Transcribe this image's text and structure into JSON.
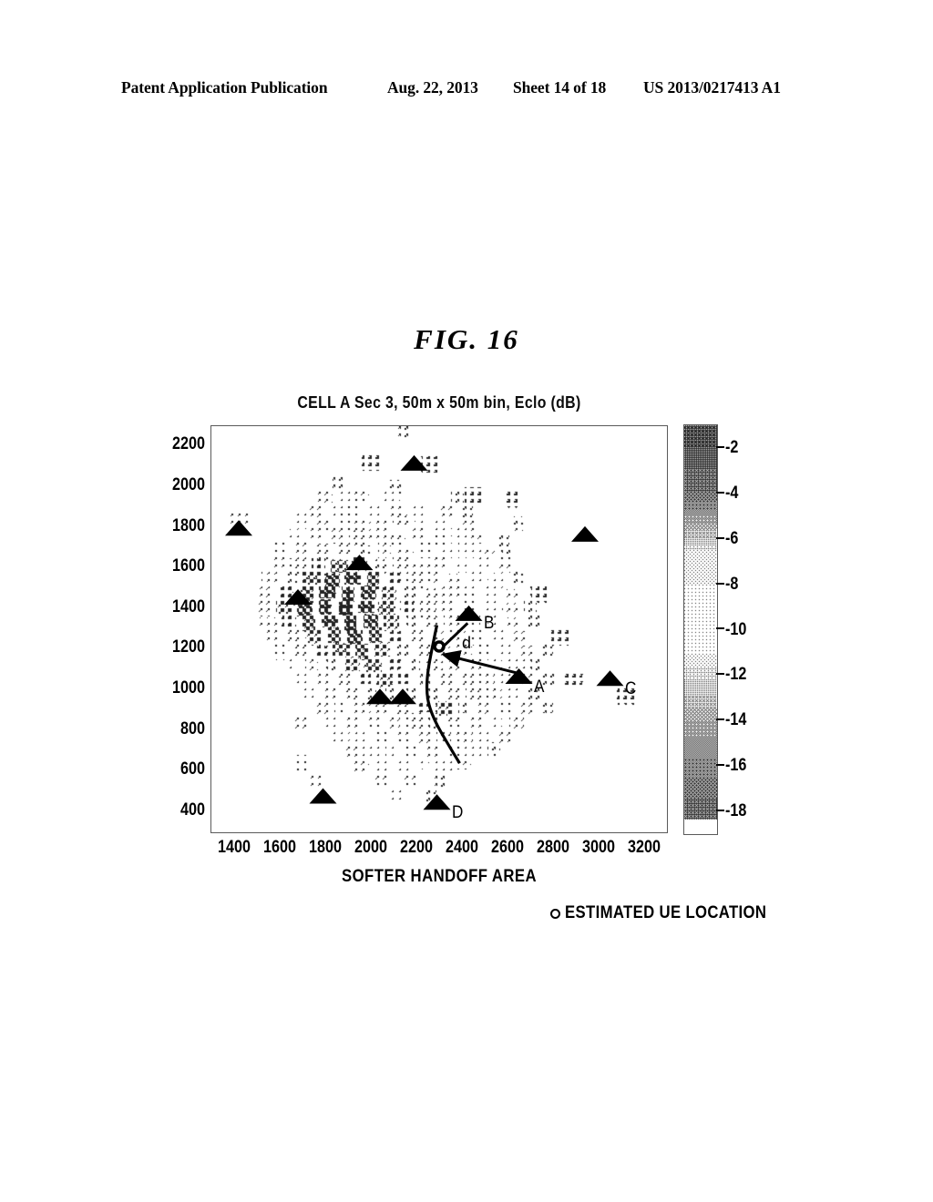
{
  "header": {
    "publication": "Patent Application Publication",
    "date": "Aug. 22, 2013",
    "sheet": "Sheet 14 of 18",
    "number": "US 2013/0217413 A1"
  },
  "figure": {
    "caption": "FIG.  16"
  },
  "legend": {
    "marker_icon": "circle-outline-icon",
    "label": "ESTIMATED UE LOCATION"
  },
  "chart_data": {
    "type": "heatmap",
    "title": "CELL A Sec 3, 50m x 50m bin, Eclo (dB)",
    "xlabel": "SOFTER HANDOFF AREA",
    "ylabel": "",
    "xlim": [
      1300,
      3300
    ],
    "ylim": [
      300,
      2300
    ],
    "xticks": [
      1400,
      1600,
      1800,
      2000,
      2200,
      2400,
      2600,
      2800,
      3000,
      3200
    ],
    "yticks": [
      2200,
      2000,
      1800,
      1600,
      1400,
      1200,
      1000,
      800,
      600,
      400
    ],
    "grid": false,
    "bin_size_m": 50,
    "colorbar": {
      "label": "Eclo (dB)",
      "ticks": [
        -2,
        -4,
        -6,
        -8,
        -10,
        -12,
        -14,
        -16,
        -18
      ],
      "range": [
        -1,
        -19
      ],
      "colormap": "gray-inverted-bow",
      "dark_low": "#2b2b2b",
      "light_mid": "#f2f2f2",
      "dark_high": "#4a4a4a"
    },
    "sites": [
      {
        "label": "",
        "x": 1420,
        "y": 1790
      },
      {
        "label": "",
        "x": 2190,
        "y": 2110
      },
      {
        "label": "",
        "x": 1950,
        "y": 1620
      },
      {
        "label": "",
        "x": 1680,
        "y": 1450
      },
      {
        "label": "",
        "x": 2940,
        "y": 1760
      },
      {
        "label": "B",
        "x": 2430,
        "y": 1370
      },
      {
        "label": "A",
        "x": 2650,
        "y": 1060
      },
      {
        "label": "C",
        "x": 3050,
        "y": 1050
      },
      {
        "label": "",
        "x": 2040,
        "y": 960
      },
      {
        "label": "",
        "x": 2140,
        "y": 960
      },
      {
        "label": "",
        "x": 1790,
        "y": 470
      },
      {
        "label": "D",
        "x": 2290,
        "y": 440
      }
    ],
    "annotations": [
      {
        "name": "estimated-ue-location",
        "type": "circle",
        "x": 2300,
        "y": 1200
      },
      {
        "name": "distance-label",
        "type": "text",
        "text": "d",
        "x": 2420,
        "y": 1180
      },
      {
        "name": "distance-arrow",
        "type": "arrow",
        "from": [
          2650,
          1090
        ],
        "to": [
          2305,
          1190
        ]
      },
      {
        "name": "site-b-pointer",
        "type": "arrow",
        "from": [
          2430,
          1330
        ],
        "to": [
          2305,
          1215
        ]
      },
      {
        "name": "softer-handoff-boundary",
        "type": "curve"
      }
    ],
    "bins": [
      [
        2150,
        2280,
        4
      ],
      [
        2000,
        2120,
        3
      ],
      [
        2260,
        2110,
        3
      ],
      [
        1860,
        2020,
        4
      ],
      [
        2110,
        2000,
        4
      ],
      [
        1800,
        1950,
        5
      ],
      [
        1900,
        1950,
        6
      ],
      [
        1960,
        1960,
        5
      ],
      [
        2090,
        1960,
        6
      ],
      [
        2380,
        1950,
        4
      ],
      [
        2450,
        1960,
        3
      ],
      [
        2620,
        1940,
        3
      ],
      [
        1760,
        1880,
        5
      ],
      [
        1860,
        1890,
        7
      ],
      [
        1930,
        1880,
        8
      ],
      [
        2010,
        1870,
        7
      ],
      [
        2120,
        1890,
        9
      ],
      [
        2210,
        1870,
        6
      ],
      [
        2330,
        1880,
        5
      ],
      [
        2420,
        1880,
        4
      ],
      [
        1420,
        1840,
        10
      ],
      [
        1700,
        1830,
        6
      ],
      [
        1790,
        1820,
        5
      ],
      [
        1880,
        1830,
        8
      ],
      [
        1960,
        1820,
        10
      ],
      [
        2050,
        1810,
        9
      ],
      [
        2130,
        1830,
        12
      ],
      [
        2220,
        1820,
        7
      ],
      [
        2310,
        1820,
        6
      ],
      [
        2430,
        1810,
        5
      ],
      [
        2640,
        1820,
        4
      ],
      [
        1670,
        1760,
        7
      ],
      [
        1760,
        1770,
        9
      ],
      [
        1850,
        1760,
        11
      ],
      [
        1940,
        1750,
        13
      ],
      [
        2030,
        1760,
        10
      ],
      [
        2120,
        1750,
        12
      ],
      [
        2210,
        1760,
        9
      ],
      [
        2300,
        1750,
        8
      ],
      [
        2390,
        1760,
        6
      ],
      [
        2470,
        1750,
        5
      ],
      [
        2580,
        1740,
        4
      ],
      [
        1610,
        1690,
        8
      ],
      [
        1700,
        1690,
        11
      ],
      [
        1790,
        1680,
        13
      ],
      [
        1880,
        1690,
        12
      ],
      [
        1970,
        1680,
        14
      ],
      [
        2060,
        1690,
        11
      ],
      [
        2150,
        1680,
        10
      ],
      [
        2240,
        1690,
        8
      ],
      [
        2330,
        1680,
        7
      ],
      [
        2420,
        1690,
        6
      ],
      [
        2510,
        1680,
        5
      ],
      [
        2600,
        1680,
        4
      ],
      [
        1950,
        1620,
        16
      ],
      [
        1590,
        1620,
        9
      ],
      [
        1680,
        1610,
        13
      ],
      [
        1770,
        1620,
        15
      ],
      [
        1860,
        1610,
        17
      ],
      [
        2040,
        1610,
        14
      ],
      [
        2130,
        1620,
        12
      ],
      [
        2220,
        1610,
        10
      ],
      [
        2310,
        1620,
        9
      ],
      [
        2400,
        1610,
        7
      ],
      [
        2490,
        1620,
        6
      ],
      [
        2580,
        1610,
        5
      ],
      [
        1560,
        1550,
        10
      ],
      [
        1650,
        1540,
        14
      ],
      [
        1740,
        1550,
        17
      ],
      [
        1830,
        1540,
        19
      ],
      [
        1920,
        1550,
        20
      ],
      [
        2010,
        1540,
        18
      ],
      [
        2100,
        1550,
        15
      ],
      [
        2190,
        1540,
        13
      ],
      [
        2280,
        1550,
        11
      ],
      [
        2370,
        1540,
        9
      ],
      [
        2460,
        1550,
        7
      ],
      [
        2550,
        1540,
        6
      ],
      [
        2640,
        1550,
        4
      ],
      [
        1540,
        1470,
        11
      ],
      [
        1630,
        1480,
        15
      ],
      [
        1720,
        1470,
        18
      ],
      [
        1810,
        1480,
        20
      ],
      [
        1900,
        1470,
        21
      ],
      [
        1990,
        1480,
        19
      ],
      [
        2080,
        1470,
        16
      ],
      [
        2170,
        1480,
        14
      ],
      [
        2260,
        1470,
        12
      ],
      [
        2350,
        1480,
        10
      ],
      [
        2440,
        1470,
        8
      ],
      [
        2530,
        1480,
        6
      ],
      [
        2620,
        1470,
        5
      ],
      [
        2740,
        1470,
        3
      ],
      [
        1680,
        1450,
        16
      ],
      [
        1530,
        1400,
        11
      ],
      [
        1620,
        1410,
        16
      ],
      [
        1710,
        1400,
        19
      ],
      [
        1800,
        1410,
        21
      ],
      [
        1890,
        1400,
        22
      ],
      [
        1980,
        1410,
        20
      ],
      [
        2070,
        1400,
        17
      ],
      [
        2160,
        1410,
        15
      ],
      [
        2250,
        1400,
        13
      ],
      [
        2340,
        1410,
        10
      ],
      [
        2430,
        1400,
        8
      ],
      [
        2520,
        1410,
        6
      ],
      [
        2610,
        1400,
        5
      ],
      [
        2700,
        1410,
        4
      ],
      [
        1550,
        1330,
        10
      ],
      [
        1640,
        1340,
        15
      ],
      [
        1730,
        1330,
        18
      ],
      [
        1820,
        1340,
        20
      ],
      [
        1910,
        1330,
        21
      ],
      [
        2000,
        1340,
        19
      ],
      [
        2090,
        1330,
        16
      ],
      [
        2180,
        1340,
        14
      ],
      [
        2270,
        1330,
        12
      ],
      [
        2360,
        1340,
        10
      ],
      [
        2450,
        1330,
        8
      ],
      [
        2540,
        1340,
        7
      ],
      [
        2630,
        1330,
        5
      ],
      [
        2720,
        1340,
        4
      ],
      [
        1570,
        1260,
        9
      ],
      [
        1660,
        1270,
        13
      ],
      [
        1750,
        1260,
        16
      ],
      [
        1840,
        1270,
        18
      ],
      [
        1930,
        1260,
        19
      ],
      [
        2020,
        1270,
        18
      ],
      [
        2110,
        1260,
        15
      ],
      [
        2200,
        1270,
        13
      ],
      [
        2290,
        1260,
        11
      ],
      [
        2380,
        1270,
        9
      ],
      [
        2470,
        1260,
        8
      ],
      [
        2560,
        1270,
        6
      ],
      [
        2650,
        1260,
        5
      ],
      [
        2830,
        1260,
        3
      ],
      [
        1600,
        1190,
        8
      ],
      [
        1690,
        1200,
        12
      ],
      [
        1780,
        1190,
        15
      ],
      [
        1870,
        1200,
        17
      ],
      [
        1960,
        1190,
        18
      ],
      [
        2050,
        1200,
        16
      ],
      [
        2140,
        1190,
        14
      ],
      [
        2230,
        1200,
        12
      ],
      [
        2320,
        1190,
        11
      ],
      [
        2410,
        1200,
        9
      ],
      [
        2500,
        1190,
        8
      ],
      [
        2590,
        1200,
        6
      ],
      [
        2680,
        1190,
        5
      ],
      [
        2770,
        1200,
        4
      ],
      [
        1650,
        1120,
        7
      ],
      [
        1740,
        1130,
        11
      ],
      [
        1830,
        1120,
        14
      ],
      [
        1920,
        1130,
        16
      ],
      [
        2010,
        1120,
        17
      ],
      [
        2100,
        1130,
        15
      ],
      [
        2190,
        1120,
        14
      ],
      [
        2280,
        1130,
        13
      ],
      [
        2370,
        1120,
        11
      ],
      [
        2460,
        1130,
        9
      ],
      [
        2550,
        1120,
        7
      ],
      [
        2640,
        1130,
        6
      ],
      [
        2730,
        1120,
        4
      ],
      [
        1700,
        1050,
        7
      ],
      [
        1790,
        1060,
        10
      ],
      [
        1880,
        1050,
        13
      ],
      [
        1970,
        1060,
        15
      ],
      [
        2060,
        1050,
        16
      ],
      [
        2150,
        1060,
        15
      ],
      [
        2240,
        1050,
        14
      ],
      [
        2330,
        1060,
        13
      ],
      [
        2420,
        1050,
        12
      ],
      [
        2510,
        1060,
        9
      ],
      [
        2600,
        1050,
        7
      ],
      [
        2690,
        1060,
        5
      ],
      [
        2780,
        1050,
        4
      ],
      [
        2890,
        1050,
        3
      ],
      [
        1730,
        980,
        6
      ],
      [
        1820,
        990,
        9
      ],
      [
        1910,
        980,
        12
      ],
      [
        2000,
        990,
        14
      ],
      [
        2090,
        980,
        14
      ],
      [
        2180,
        990,
        14
      ],
      [
        2270,
        980,
        14
      ],
      [
        2360,
        990,
        13
      ],
      [
        2450,
        980,
        12
      ],
      [
        2540,
        990,
        9
      ],
      [
        2630,
        980,
        6
      ],
      [
        2720,
        990,
        4
      ],
      [
        3120,
        970,
        3
      ],
      [
        1780,
        910,
        5
      ],
      [
        1870,
        920,
        8
      ],
      [
        1960,
        910,
        10
      ],
      [
        2050,
        920,
        12
      ],
      [
        2140,
        910,
        13
      ],
      [
        2230,
        920,
        15
      ],
      [
        2320,
        910,
        16
      ],
      [
        2410,
        920,
        14
      ],
      [
        2500,
        910,
        11
      ],
      [
        2590,
        920,
        8
      ],
      [
        2680,
        910,
        5
      ],
      [
        2770,
        920,
        4
      ],
      [
        1700,
        840,
        5
      ],
      [
        1830,
        850,
        7
      ],
      [
        1920,
        840,
        9
      ],
      [
        2010,
        850,
        10
      ],
      [
        2100,
        840,
        11
      ],
      [
        2190,
        850,
        13
      ],
      [
        2280,
        840,
        14
      ],
      [
        2370,
        850,
        12
      ],
      [
        2460,
        840,
        10
      ],
      [
        2550,
        850,
        7
      ],
      [
        2640,
        840,
        5
      ],
      [
        1870,
        770,
        6
      ],
      [
        1960,
        780,
        7
      ],
      [
        2050,
        770,
        8
      ],
      [
        2140,
        780,
        9
      ],
      [
        2230,
        770,
        11
      ],
      [
        2320,
        780,
        12
      ],
      [
        2410,
        770,
        10
      ],
      [
        2500,
        780,
        7
      ],
      [
        2590,
        770,
        5
      ],
      [
        1910,
        700,
        5
      ],
      [
        2000,
        710,
        6
      ],
      [
        2090,
        700,
        7
      ],
      [
        2180,
        710,
        8
      ],
      [
        2270,
        700,
        9
      ],
      [
        2360,
        710,
        8
      ],
      [
        2450,
        700,
        6
      ],
      [
        2540,
        710,
        4
      ],
      [
        1700,
        640,
        8
      ],
      [
        1960,
        630,
        5
      ],
      [
        2050,
        640,
        6
      ],
      [
        2140,
        630,
        6
      ],
      [
        2230,
        640,
        7
      ],
      [
        2320,
        630,
        6
      ],
      [
        2410,
        640,
        5
      ],
      [
        1760,
        560,
        9
      ],
      [
        2050,
        560,
        5
      ],
      [
        2180,
        560,
        5
      ],
      [
        2310,
        560,
        4
      ],
      [
        2110,
        490,
        6
      ],
      [
        2260,
        480,
        4
      ]
    ]
  }
}
